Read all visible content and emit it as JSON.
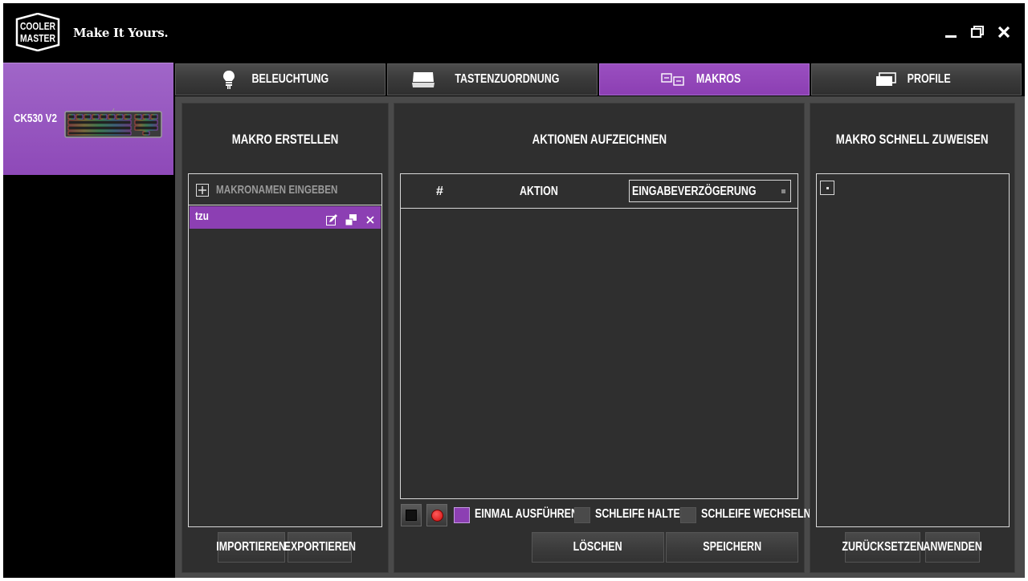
{
  "header": {
    "logo_text": [
      "COOLER",
      "MASTER"
    ],
    "tagline": "Make It Yours.",
    "window_controls": [
      "minimize-icon",
      "restore-icon",
      "close-icon"
    ]
  },
  "device": {
    "name": "CK530 V2"
  },
  "tabs": [
    {
      "label": "BELEUCHTUNG",
      "icon": "lightbulb-icon",
      "active": false
    },
    {
      "label": "TASTENZUORDNUNG",
      "icon": "keyboard-icon",
      "active": false
    },
    {
      "label": "MAKROS",
      "icon": "macro-icon",
      "active": true
    },
    {
      "label": "PROFILE",
      "icon": "profile-cards-icon",
      "active": false
    }
  ],
  "create_panel": {
    "title": "MAKRO ERSTELLEN",
    "add_placeholder": "MAKRONAMEN EINGEBEN",
    "macros": [
      {
        "name": "tzu",
        "selected": true
      }
    ],
    "import_label": "IMPORTIEREN",
    "export_label": "EXPORTIEREN"
  },
  "record_panel": {
    "title": "AKTIONEN AUFZEICHNEN",
    "columns": {
      "number": "#",
      "action": "AKTION",
      "delay": "EINGABEVERZÖGERUNG"
    },
    "playback_options": [
      {
        "label": "EINMAL AUSFÜHREN",
        "checked": true
      },
      {
        "label": "SCHLEIFE HALTEN",
        "checked": false
      },
      {
        "label": "SCHLEIFE WECHSELN",
        "checked": false
      }
    ],
    "delete_label": "LÖSCHEN",
    "save_label": "SPEICHERN"
  },
  "assign_panel": {
    "title": "MAKRO SCHNELL ZUWEISEN",
    "reset_label": "ZURÜCKSETZEN",
    "apply_label": "ANWENDEN"
  },
  "colors": {
    "accent": "#8c3fb3",
    "panel": "#2f2f2f",
    "background": "#000000"
  }
}
